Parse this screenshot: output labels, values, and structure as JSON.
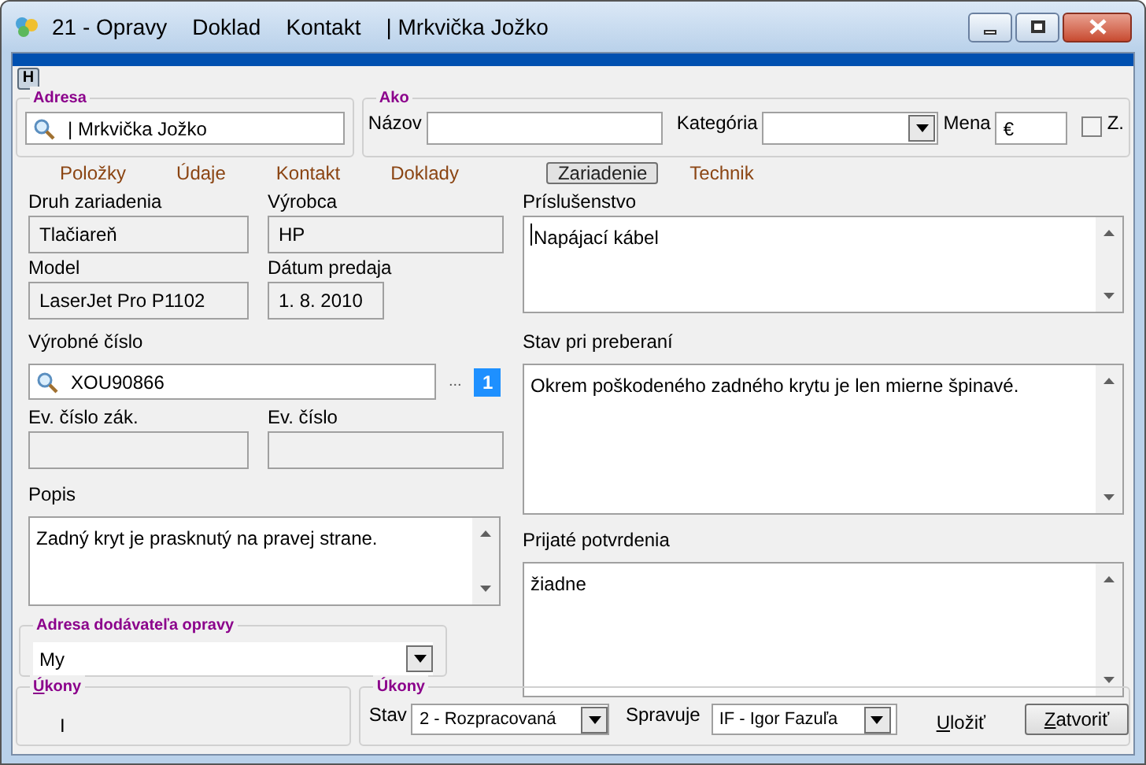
{
  "window": {
    "title_parts": [
      "21 - Opravy",
      "Doklad",
      "Kontakt",
      "| Mrkvička Jožko"
    ]
  },
  "h_button": "H",
  "adresa": {
    "legend": "Adresa",
    "value": "| Mrkvička Jožko"
  },
  "ako": {
    "legend": "Ako",
    "nazov_label": "Názov",
    "kategoria_label": "Kategória",
    "mena_label": "Mena",
    "mena_value": "€",
    "z_label": "Z.",
    "z_checked": false
  },
  "tabs": [
    {
      "label": "Položky",
      "selected": false
    },
    {
      "label": "Údaje",
      "selected": false
    },
    {
      "label": "Kontakt",
      "selected": false
    },
    {
      "label": "Doklady",
      "selected": false
    },
    {
      "label": "Zariadenie",
      "selected": true
    },
    {
      "label": "Technik",
      "selected": false
    }
  ],
  "device": {
    "druh_label": "Druh zariadenia",
    "druh": "Tlačiareň",
    "vyrobca_label": "Výrobca",
    "vyrobca": "HP",
    "model_label": "Model",
    "model": "LaserJet Pro P1102",
    "datum_label": "Dátum predaja",
    "datum": "1. 8. 2010",
    "cislo_label": "Výrobné číslo",
    "cislo": "XOU90866",
    "ellipsis": "...",
    "count": "1",
    "ev_zak_label": "Ev. číslo zák.",
    "ev_label": "Ev. číslo",
    "popis_label": "Popis",
    "popis": "Zadný kryt je prasknutý na pravej strane."
  },
  "dodavatel": {
    "legend": "Adresa dodávateľa opravy",
    "value": "My"
  },
  "prislusenstvo": {
    "label": "Príslušenstvo",
    "value": "Napájací kábel"
  },
  "stav_pri": {
    "label": "Stav pri preberaní",
    "value": "Okrem poškodeného zadného krytu je len mierne špinavé."
  },
  "prijate": {
    "label": "Prijaté potvrdenia",
    "value": "žiadne"
  },
  "ukony_left": {
    "legend": "Úkony",
    "value": "I"
  },
  "ukony_right": {
    "legend": "Úkony",
    "stav_label": "Stav",
    "stav": "2 - Rozpracovaná",
    "spravuje_label": "Spravuje",
    "spravuje": "IF - Igor Fazuľa"
  },
  "buttons": [
    {
      "label": "Uložiť",
      "kind": "link",
      "mnemonic": true
    },
    {
      "label": "Zatvoriť",
      "kind": "button",
      "mnemonic": true
    }
  ]
}
